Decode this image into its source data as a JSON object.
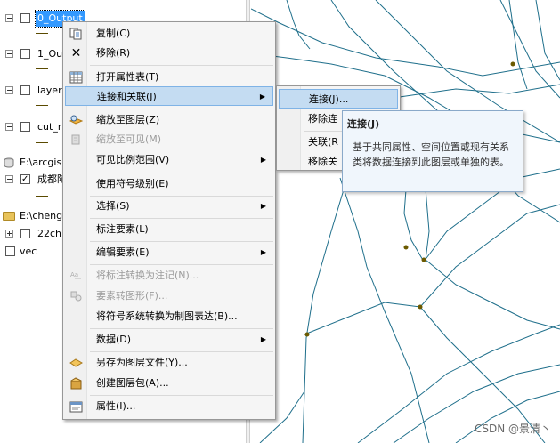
{
  "toc": {
    "layers": [
      {
        "label": "0_Output",
        "checked": false,
        "selected": true
      },
      {
        "label": "1_Ou",
        "checked": false
      },
      {
        "label": "layer",
        "checked": false
      },
      {
        "label": "cut_r",
        "checked": false
      }
    ],
    "db_path": "E:\\arcgis",
    "db_layer": "成都陀",
    "folder_path": "E:\\cheng",
    "folder_layer": "22ch",
    "vec_layer": "vec"
  },
  "context_menu": {
    "items": [
      {
        "label": "复制(C)",
        "icon": "copy-icon"
      },
      {
        "label": "移除(R)",
        "icon": "remove-x-icon"
      },
      {
        "label": "打开属性表(T)",
        "icon": "table-icon"
      },
      {
        "label": "连接和关联(J)",
        "highlighted": true,
        "submenu": true
      },
      {
        "label": "缩放至图层(Z)",
        "icon": "zoom-layer-icon"
      },
      {
        "label": "缩放至可见(M)",
        "disabled": true,
        "icon": "zoom-visible-icon"
      },
      {
        "label": "可见比例范围(V)",
        "submenu": true
      },
      {
        "label": "使用符号级别(E)"
      },
      {
        "label": "选择(S)",
        "submenu": true
      },
      {
        "label": "标注要素(L)"
      },
      {
        "label": "编辑要素(E)",
        "submenu": true
      },
      {
        "label": "将标注转换为注记(N)...",
        "disabled": true,
        "icon": "convert-label-icon"
      },
      {
        "label": "要素转图形(F)...",
        "disabled": true,
        "icon": "feature-graphic-icon"
      },
      {
        "label": "将符号系统转换为制图表达(B)..."
      },
      {
        "label": "数据(D)",
        "submenu": true
      },
      {
        "label": "另存为图层文件(Y)...",
        "icon": "layer-file-icon"
      },
      {
        "label": "创建图层包(A)...",
        "icon": "layer-package-icon"
      },
      {
        "label": "属性(I)...",
        "icon": "properties-icon"
      }
    ]
  },
  "submenu": {
    "items": [
      {
        "label": "连接(J)...",
        "highlighted": true
      },
      {
        "label": "移除连"
      },
      {
        "label": "关联(R"
      },
      {
        "label": "移除关"
      }
    ]
  },
  "tooltip": {
    "title": "连接(J)",
    "body": "基于共同属性、空间位置或现有关系类将数据连接到此图层或单独的表。"
  },
  "watermark": "CSDN @景清丶",
  "colors": {
    "map_line": "#1f6f8b",
    "map_vertex": "#6b5a00",
    "highlight": "#c4dcf2",
    "selection": "#3399ff"
  }
}
